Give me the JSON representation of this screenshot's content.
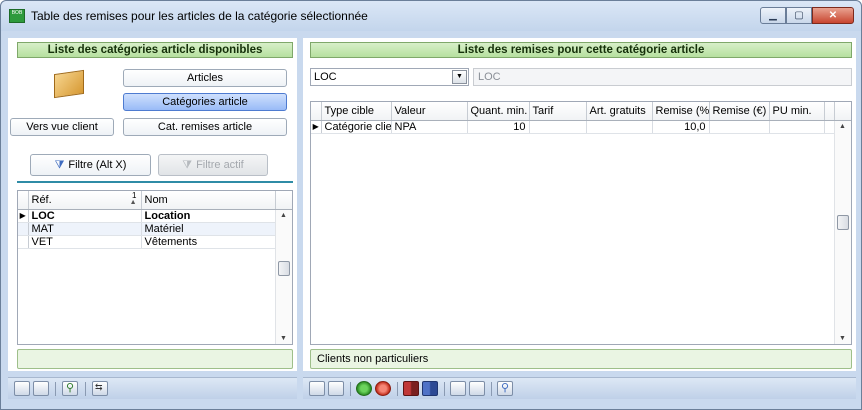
{
  "window": {
    "title": "Table des remises pour les articles de la catégorie sélectionnée",
    "app_icon_label": "BOB"
  },
  "left_panel": {
    "header": "Liste des catégories article disponibles",
    "buttons": {
      "articles": "Articles",
      "categories": "Catégories article",
      "client_view": "Vers vue client",
      "discount_categories": "Cat. remises article",
      "filter": "Filtre (Alt X)",
      "active_filter": "Filtre actif"
    },
    "table": {
      "columns": [
        "Réf.",
        "Nom"
      ],
      "sort_indicator": "1",
      "rows": [
        {
          "ref": "LOC",
          "name": "Location",
          "current": true
        },
        {
          "ref": "MAT",
          "name": "Matériel",
          "current": false
        },
        {
          "ref": "VET",
          "name": "Vêtements",
          "current": false
        }
      ]
    },
    "status": ""
  },
  "right_panel": {
    "header": "Liste des remises pour cette catégorie article",
    "category_select": "LOC",
    "category_display": "LOC",
    "table": {
      "columns": [
        "Type cible",
        "Valeur",
        "Quant. min.",
        "Tarif",
        "Art. gratuits",
        "Remise (%)",
        "Remise (€)",
        "PU min."
      ],
      "rows": [
        {
          "type": "Catégorie client",
          "valeur": "NPA",
          "quant_min": "10",
          "tarif": "",
          "art_gratuits": "",
          "remise_pct": "10,0",
          "remise_eur": "",
          "pu_min": ""
        }
      ]
    },
    "status": "Clients non particuliers"
  },
  "colors": {
    "panel_header_green": "#b6e09f",
    "selected_button_blue": "#99bbf7",
    "window_frame": "#c9d9ee"
  },
  "icons": {
    "box": "category-box-icon",
    "filter": "funnel-icon",
    "active_filter": "funnel-disabled-icon"
  }
}
